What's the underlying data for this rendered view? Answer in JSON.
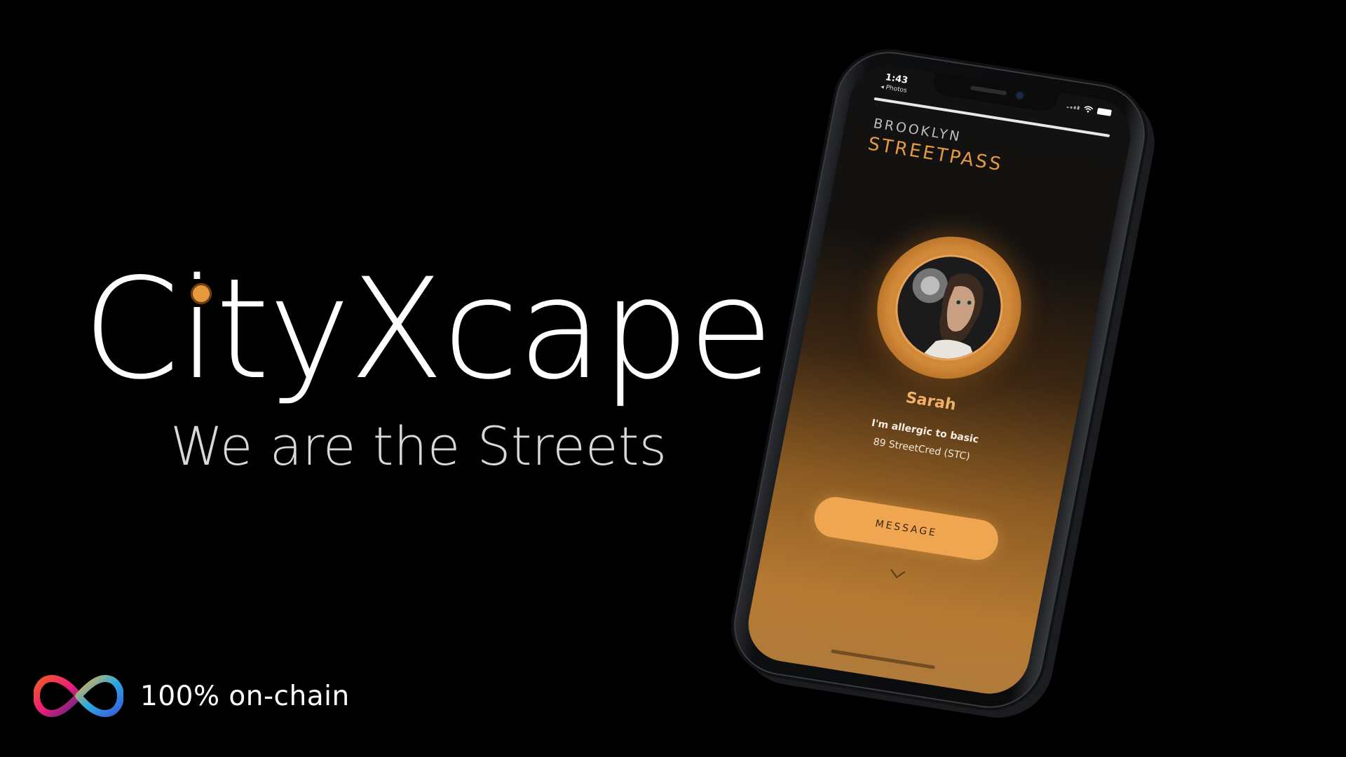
{
  "hero": {
    "title": "CityXcape",
    "tagline": "We are the Streets",
    "accent_color": "#e49a3b"
  },
  "footer": {
    "icon": "infinity-icon",
    "label": "100% on-chain"
  },
  "phone": {
    "status_bar": {
      "time": "1:43",
      "back_label": "◂ Photos"
    },
    "app": {
      "city": "BROOKLYN",
      "brand": "STREETPASS",
      "brand_color": "#e39a42"
    },
    "profile": {
      "name": "Sarah",
      "bio": "I'm allergic to basic",
      "cred": "89 StreetCred (STC)",
      "message_button": "MESSAGE",
      "expand_icon": "chevron-down-icon"
    }
  }
}
